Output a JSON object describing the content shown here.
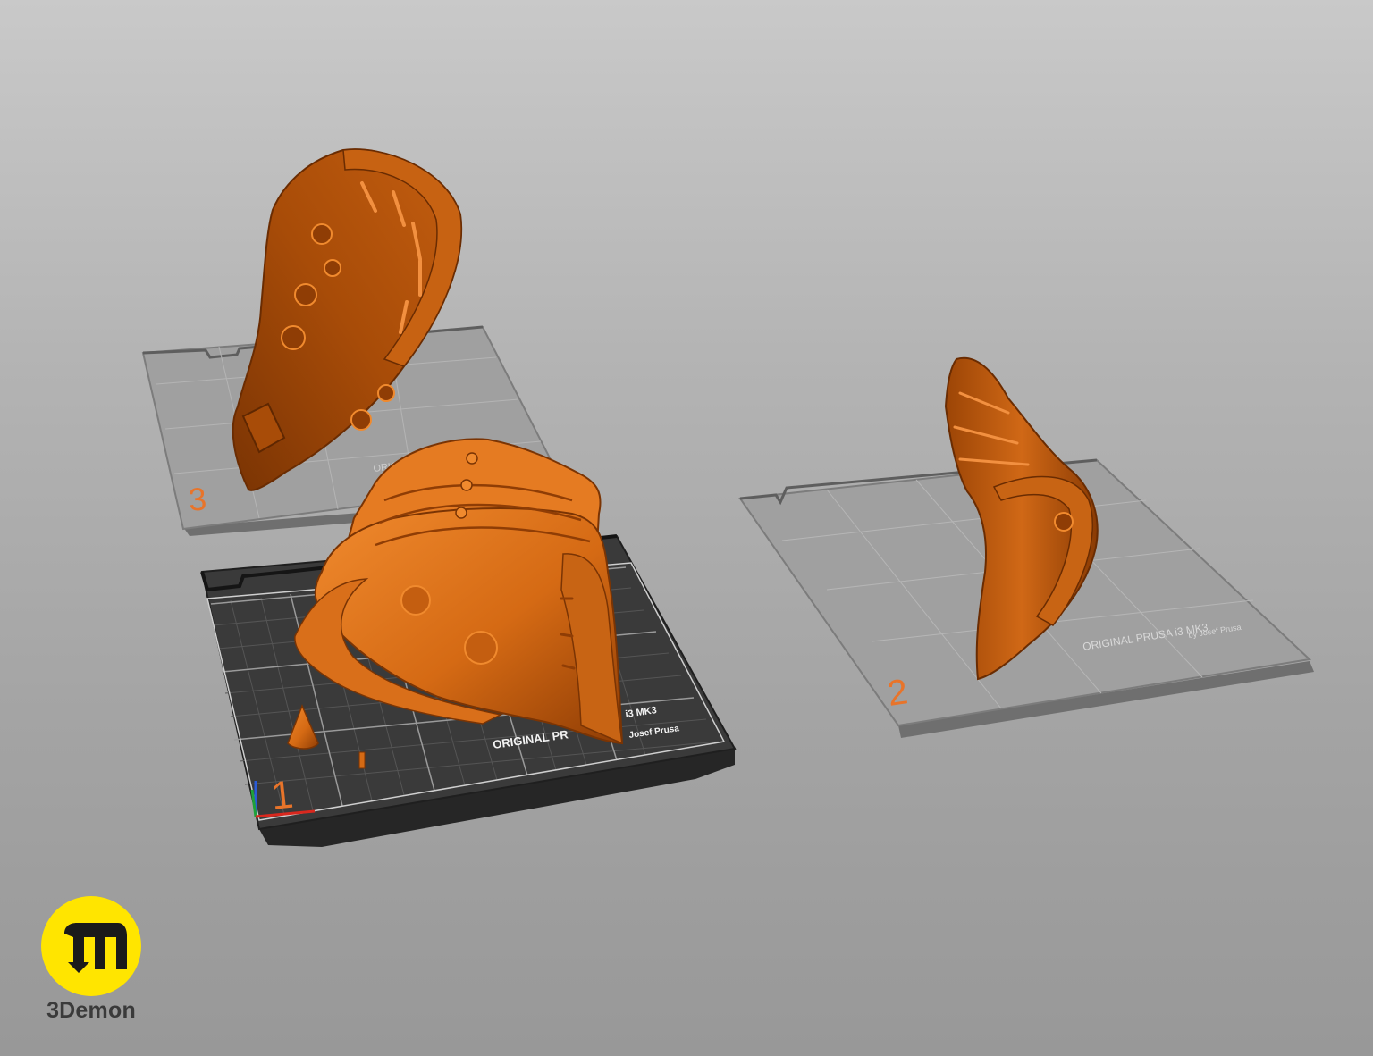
{
  "scene": {
    "background_top": "#c9c9c9",
    "background_bottom": "#989898",
    "model_color": "#d56a14",
    "model_shade": "#8f3d05",
    "model_highlight": "#f08a2e",
    "active_bed_color": "#3c3c3c",
    "inactive_bed_color": "#9a9a9a",
    "bed_number_color": "#e8742a"
  },
  "beds": [
    {
      "number": "1",
      "state": "active",
      "label_line1": "ORIGINAL PR",
      "label_model": "i3  MK3",
      "label_line2": "Josef Prusa"
    },
    {
      "number": "2",
      "state": "inactive",
      "label_line1": "ORIGINAL PRUSA i3 MK3",
      "label_line2": "by Josef Prusa"
    },
    {
      "number": "3",
      "state": "inactive",
      "label_line1": "ORIGIN"
    }
  ],
  "brand": {
    "name": "3Demon",
    "logo_icon": "3demon-logo-icon",
    "color": "#ffe500"
  }
}
